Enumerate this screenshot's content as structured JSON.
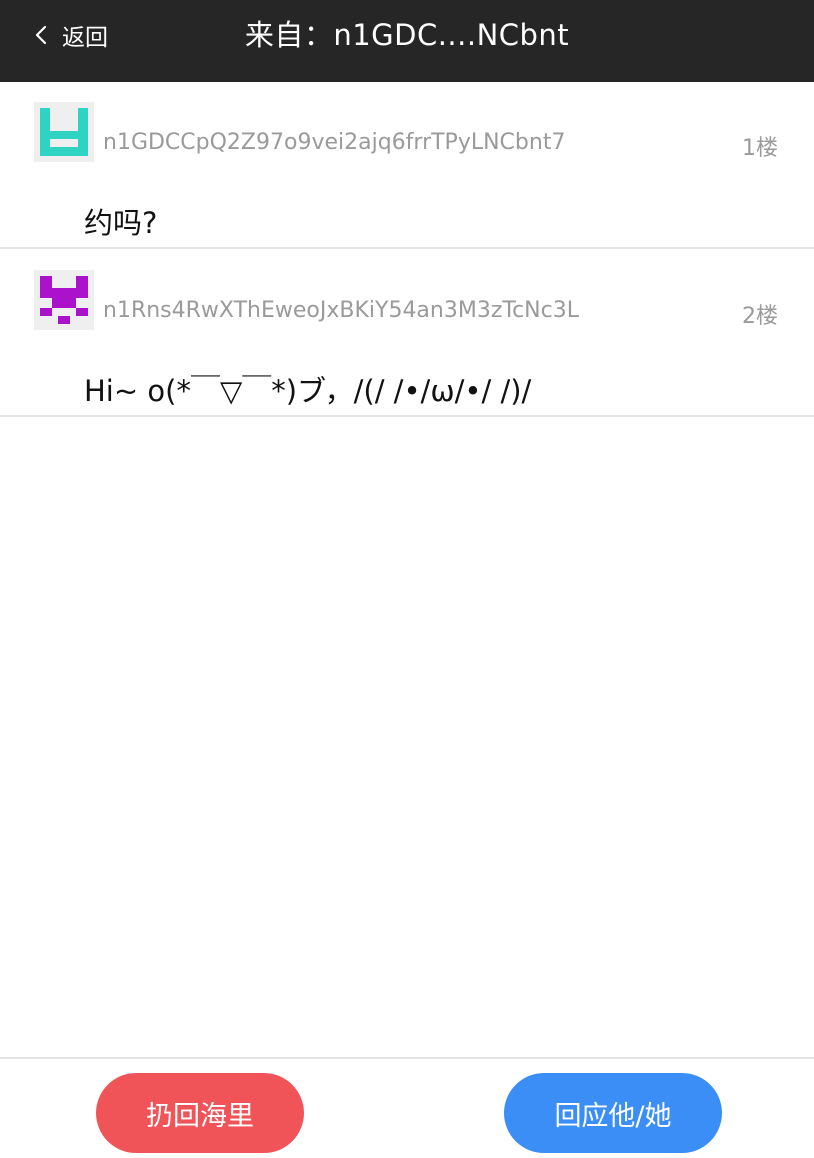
{
  "header": {
    "back_label": "返回",
    "title": "来自：n1GDC....NCbnt",
    "background_color": "#262626"
  },
  "posts": [
    {
      "author": "n1GDCCpQ2Z97o9vei2ajq6frrTPyLNCbnt7",
      "floor": "1楼",
      "content": "约吗?",
      "avatar_color": "#2fd3c3",
      "avatar_icon": "identicon-avatar"
    },
    {
      "author": "n1Rns4RwXThEweoJxBKiY54an3M3zTcNc3L",
      "floor": "2楼",
      "content": "Hi~ o(*￣▽￣*)ブ，/(/ /•/ω/•/ /)/",
      "avatar_color": "#aa12cc",
      "avatar_icon": "identicon-avatar"
    }
  ],
  "footer": {
    "throw_back_label": "扔回海里",
    "reply_label": "回应他/她",
    "throw_back_color": "#f05459",
    "reply_color": "#3a8ef6"
  }
}
